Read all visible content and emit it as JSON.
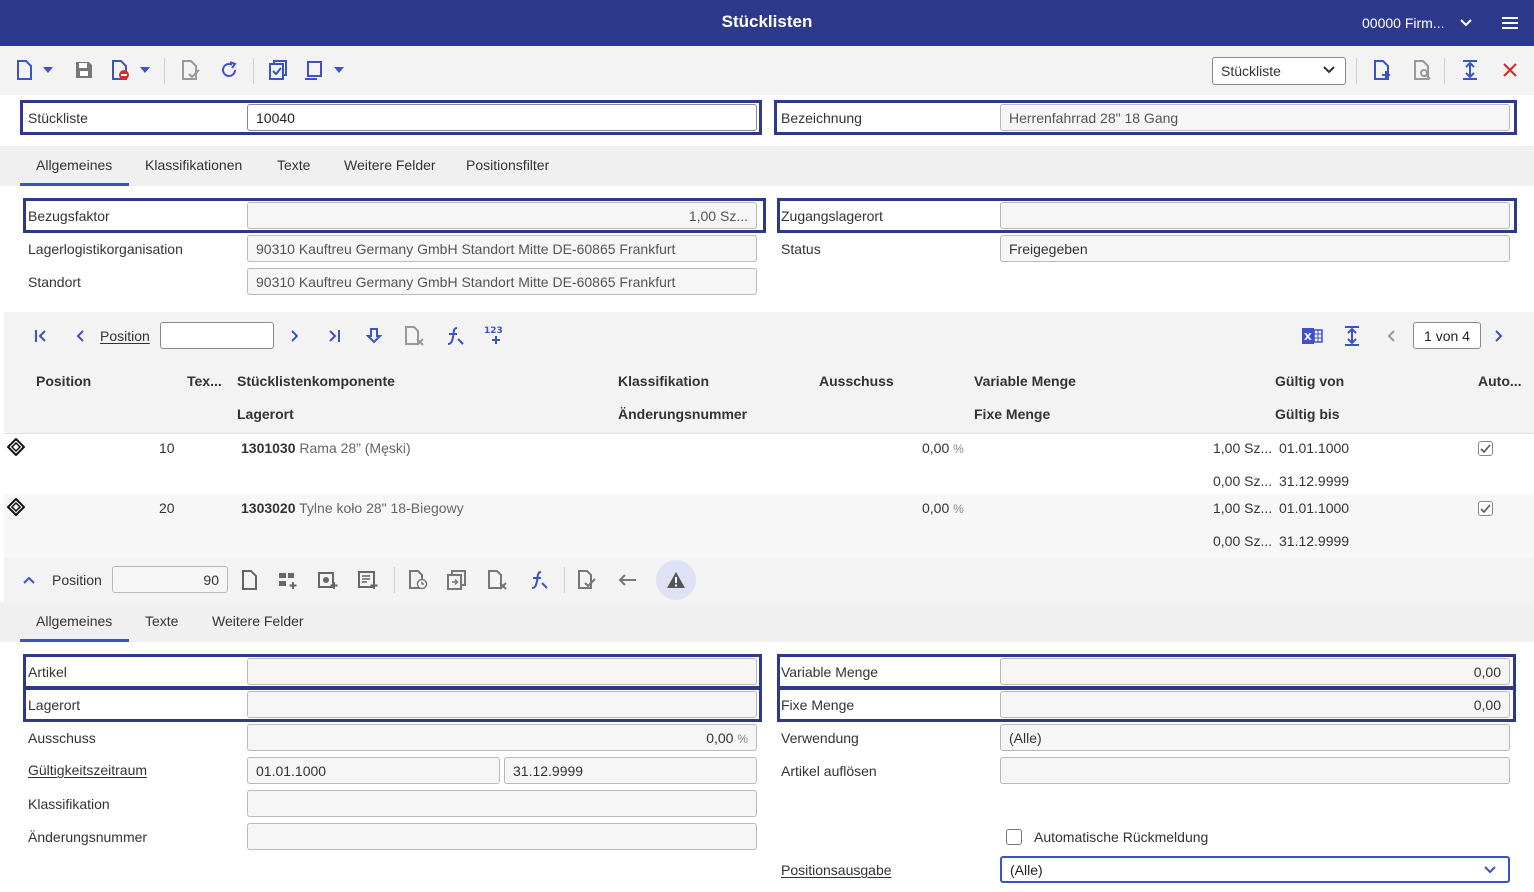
{
  "header": {
    "title": "Stücklisten",
    "company": "00000 Firm..."
  },
  "toolbar": {
    "view_select": "Stückliste"
  },
  "form": {
    "stueckliste_label": "Stückliste",
    "stueckliste_value": "10040",
    "bezeichnung_label": "Bezeichnung",
    "bezeichnung_value": "Herrenfahrrad 28\" 18 Gang"
  },
  "tabs": [
    {
      "label": "Allgemeines"
    },
    {
      "label": "Klassifikationen"
    },
    {
      "label": "Texte"
    },
    {
      "label": "Weitere Felder"
    },
    {
      "label": "Positionsfilter"
    }
  ],
  "general": {
    "bezugsfaktor_label": "Bezugsfaktor",
    "bezugsfaktor_value": "1,00 Sz...",
    "zugangslagerort_label": "Zugangslagerort",
    "zugangslagerort_value": "",
    "llo_label": "Lagerlogistikorganisation",
    "llo_code": "90310",
    "llo_name": "Kauftreu Germany GmbH Standort Mitte DE-60865 Frankfurt",
    "status_label": "Status",
    "status_value": "Freigegeben",
    "standort_label": "Standort",
    "standort_code": "90310",
    "standort_name": "Kauftreu Germany GmbH Standort Mitte DE-60865 Frankfurt"
  },
  "nav": {
    "position_label": "Position",
    "position_value": "",
    "page": "1 von 4"
  },
  "grid": {
    "headers": {
      "position": "Position",
      "tex": "Tex...",
      "komponente": "Stücklistenkomponente",
      "lagerort": "Lagerort",
      "klassifikation": "Klassifikation",
      "aenderungsnummer": "Änderungsnummer",
      "ausschuss": "Ausschuss",
      "variable_menge": "Variable Menge",
      "fixe_menge": "Fixe Menge",
      "gueltig_von": "Gültig von",
      "gueltig_bis": "Gültig bis",
      "auto": "Auto..."
    },
    "rows": [
      {
        "pos": "10",
        "code": "1301030",
        "name": "Rama 28” (Męski)",
        "ausschuss": "0,00",
        "unit": "%",
        "var_menge": "1,00 Sz...",
        "fix_menge": "0,00 Sz...",
        "von": "01.01.1000",
        "bis": "31.12.9999"
      },
      {
        "pos": "20",
        "code": "1303020",
        "name": "Tylne koło 28\" 18-Biegowy",
        "ausschuss": "0,00",
        "unit": "%",
        "var_menge": "1,00 Sz...",
        "fix_menge": "0,00 Sz...",
        "von": "01.01.1000",
        "bis": "31.12.9999"
      }
    ]
  },
  "position_detail": {
    "label": "Position",
    "value": "90",
    "tabs": [
      {
        "label": "Allgemeines"
      },
      {
        "label": "Texte"
      },
      {
        "label": "Weitere Felder"
      }
    ],
    "artikel_label": "Artikel",
    "artikel_value": "",
    "lagerort_label": "Lagerort",
    "lagerort_value": "",
    "ausschuss_label": "Ausschuss",
    "ausschuss_value": "0,00",
    "ausschuss_unit": "%",
    "gueltigkeit_label": "Gültigkeitszeitraum",
    "gueltig_von": "01.01.1000",
    "gueltig_bis": "31.12.9999",
    "klassifikation_label": "Klassifikation",
    "klassifikation_value": "",
    "aenderungsnummer_label": "Änderungsnummer",
    "aenderungsnummer_value": "",
    "variable_menge_label": "Variable Menge",
    "variable_menge_value": "0,00",
    "fixe_menge_label": "Fixe Menge",
    "fixe_menge_value": "0,00",
    "verwendung_label": "Verwendung",
    "verwendung_value": "(Alle)",
    "artikel_aufloesen_label": "Artikel auflösen",
    "artikel_aufloesen_value": "",
    "auto_rueckmeldung_label": "Automatische Rückmeldung",
    "positionsausgabe_label": "Positionsausgabe",
    "positionsausgabe_value": "(Alle)"
  },
  "colors": {
    "header_bg": "#2d3a8c",
    "accent": "#3d52c4",
    "close": "#d32f2f"
  }
}
